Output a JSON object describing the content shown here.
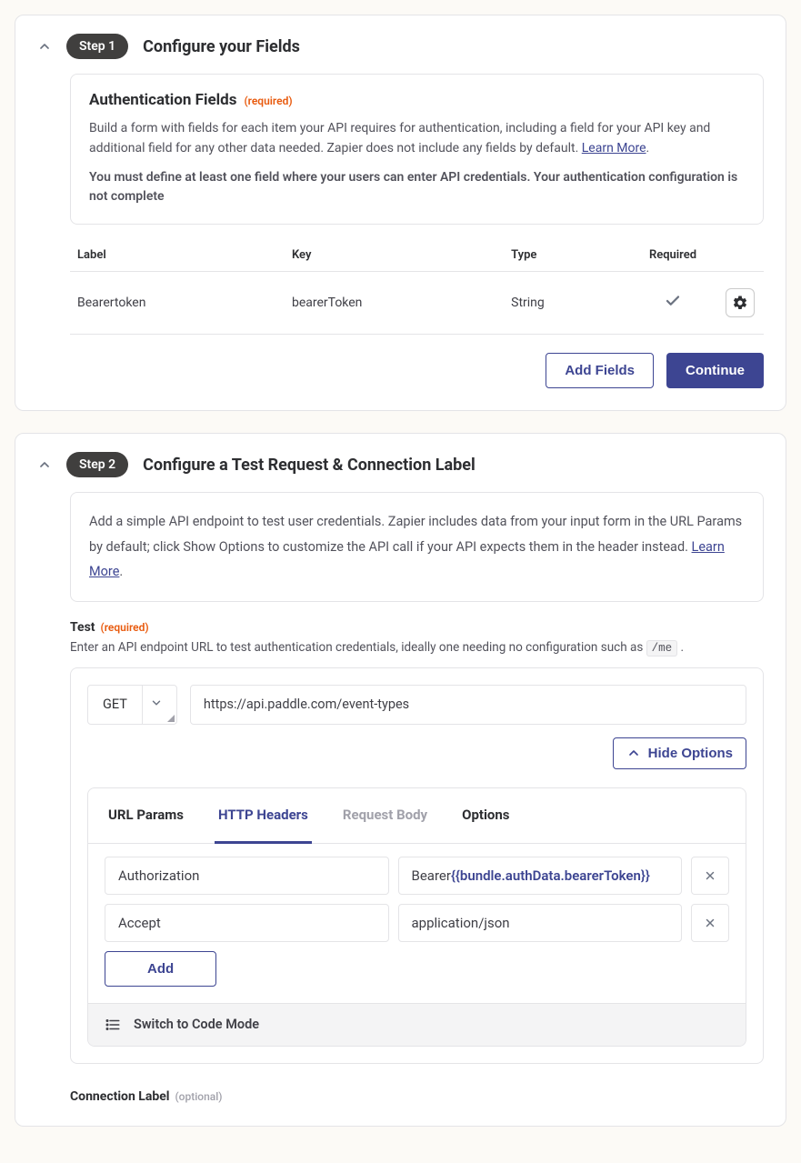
{
  "step1": {
    "pill": "Step 1",
    "title": "Configure your Fields",
    "box": {
      "title": "Authentication Fields",
      "req": "(required)",
      "desc_pre": "Build a form with fields for each item your API requires for authentication, including a field for your API key and additional field for any other data needed. Zapier does not include any fields by default. ",
      "learn_more": "Learn More",
      "desc_post": ".",
      "warn": "You must define at least one field where your users can enter API credentials. Your authentication configuration is not complete"
    },
    "table": {
      "headers": {
        "label": "Label",
        "key": "Key",
        "type": "Type",
        "required": "Required"
      },
      "row": {
        "label": "Bearertoken",
        "key": "bearerToken",
        "type": "String"
      }
    },
    "add_fields": "Add Fields",
    "continue": "Continue"
  },
  "step2": {
    "pill": "Step 2",
    "title": "Configure a Test Request & Connection Label",
    "desc_pre": "Add a simple API endpoint to test user credentials. Zapier includes data from your input form in the URL Params by default; click Show Options to customize the API call if your API expects them in the header instead. ",
    "learn_more": "Learn More",
    "desc_post": ".",
    "test_label": "Test",
    "test_req": "(required)",
    "hint_pre": "Enter an API endpoint URL to test authentication credentials, ideally one needing no configuration such as ",
    "hint_code": "/me",
    "hint_post": " .",
    "method": "GET",
    "url": "https://api.paddle.com/event-types",
    "hide_options": "Hide Options",
    "tabs": {
      "url_params": "URL Params",
      "http_headers": "HTTP Headers",
      "request_body": "Request Body",
      "options": "Options"
    },
    "headers_rows": [
      {
        "key": "Authorization",
        "val_pre": "Bearer ",
        "val_token": "{{bundle.authData.bearerToken}}"
      },
      {
        "key": "Accept",
        "val_pre": "application/json",
        "val_token": ""
      }
    ],
    "add": "Add",
    "switch_code": "Switch to Code Mode",
    "conn_label": "Connection Label",
    "conn_opt": "(optional)"
  }
}
